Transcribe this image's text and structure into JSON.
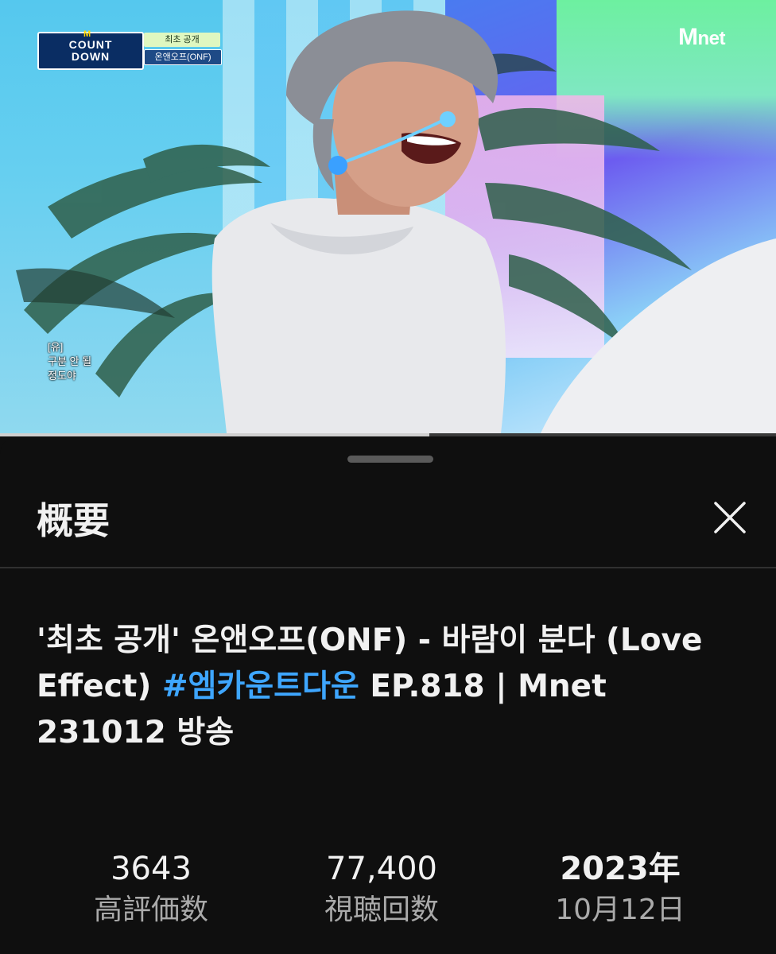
{
  "video": {
    "logo_line1": "COUNT",
    "logo_line2": "DOWN",
    "logo_m": "M",
    "caption_tag_1": "최초 공개",
    "caption_tag_2": "온앤오프(ONF)",
    "channel_watermark": "net",
    "channel_watermark_m": "M",
    "subtitle_line1": "[유]",
    "subtitle_line2": "구분 안 될",
    "subtitle_line3": "정도야",
    "progress_fraction": 0.553,
    "colors": {
      "progress_played": "#cfcfcf",
      "progress_track": "#3a3a3a"
    }
  },
  "sheet": {
    "title": "概要",
    "close_icon": "close-icon",
    "video_title_part1": "'최초 공개' 온앤오프(ONF) - 바람이 분다 (Love Effect) ",
    "video_title_hashtag": "#엠카운트다운",
    "video_title_part2": " EP.818 | Mnet 231012 방송",
    "stats": {
      "likes_value": "3643",
      "likes_label": "高評価数",
      "views_value": "77,400",
      "views_label": "視聴回数",
      "year_value": "2023年",
      "date_label": "10月12日"
    },
    "colors": {
      "background": "#0f0f0f",
      "hashtag": "#3ea6ff",
      "secondary_text": "#aaaaaa"
    }
  }
}
